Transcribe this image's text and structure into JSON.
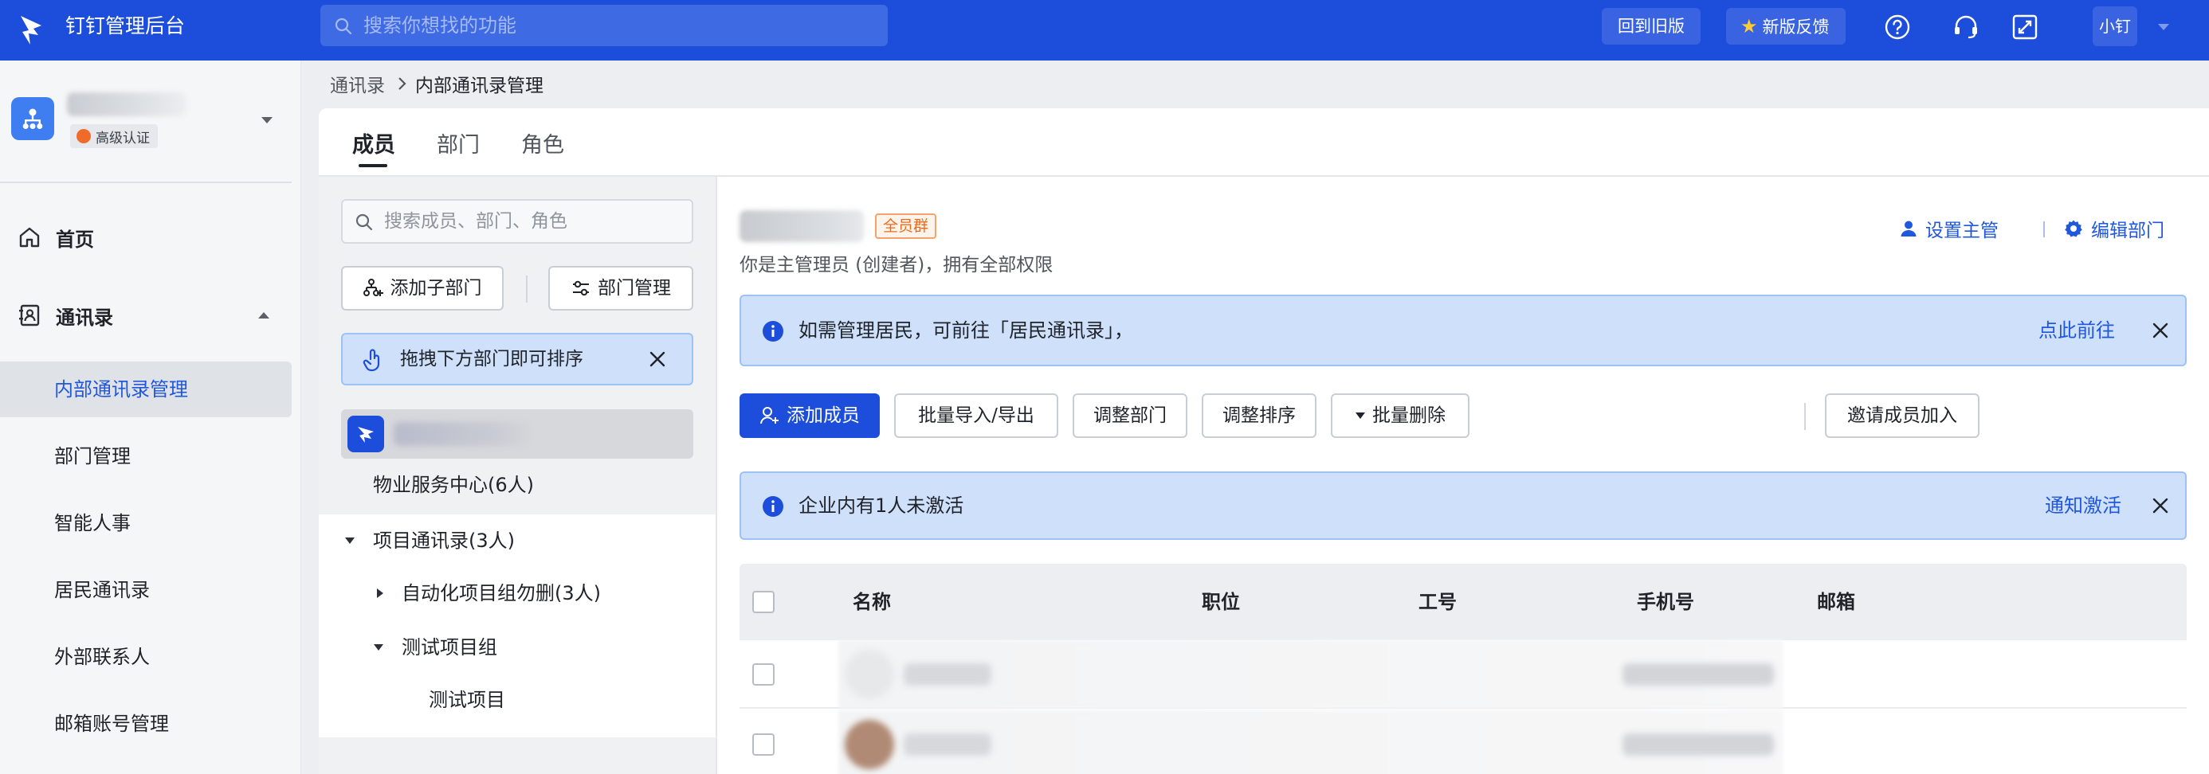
{
  "topbar": {
    "app_title": "钉钉管理后台",
    "search_placeholder": "搜索你想找的功能",
    "back_old_label": "回到旧版",
    "feedback_label": "新版反馈",
    "user_label": "小钉",
    "brand_color": "#1d4ddb"
  },
  "sidebar": {
    "org_badge": "高级认证",
    "home_label": "首页",
    "contacts_label": "通讯录",
    "items": [
      {
        "label": "内部通讯录管理",
        "active": true
      },
      {
        "label": "部门管理"
      },
      {
        "label": "智能人事"
      },
      {
        "label": "居民通讯录"
      },
      {
        "label": "外部联系人"
      },
      {
        "label": "邮箱账号管理"
      }
    ]
  },
  "breadcrumb": {
    "root": "通讯录",
    "current": "内部通讯录管理"
  },
  "tabs": [
    {
      "label": "成员",
      "active": true
    },
    {
      "label": "部门"
    },
    {
      "label": "角色"
    }
  ],
  "left_panel": {
    "search_placeholder": "搜索成员、部门、角色",
    "add_sub_dept": "添加子部门",
    "dept_manage": "部门管理",
    "drag_tip": "拖拽下方部门即可排序",
    "tree": [
      {
        "label": "物业服务中心(6人)"
      },
      {
        "label": "项目通讯录(3人)",
        "expanded": true
      },
      {
        "label": "自动化项目组勿删(3人)",
        "expanded": false
      },
      {
        "label": "测试项目组",
        "expanded": true
      },
      {
        "label": "测试项目"
      }
    ]
  },
  "right_panel": {
    "dept_tag": "全员群",
    "permission_text": "你是主管理员 (创建者)，拥有全部权限",
    "set_manager": "设置主管",
    "edit_dept": "编辑部门",
    "banner1": {
      "text": "如需管理居民，可前往「居民通讯录」，",
      "action": "点此前往"
    },
    "actions": {
      "add_member": "添加成员",
      "batch_import": "批量导入/导出",
      "adjust_dept": "调整部门",
      "adjust_order": "调整排序",
      "batch_delete": "批量删除",
      "invite": "邀请成员加入"
    },
    "banner2": {
      "text": "企业内有1人未激活",
      "action": "通知激活"
    },
    "table": {
      "columns": [
        "名称",
        "职位",
        "工号",
        "手机号",
        "邮箱"
      ]
    }
  },
  "colors": {
    "accent": "#1d4ddb",
    "link": "#1f57dd",
    "banner_bg": "#cfe0fb",
    "tag_orange": "#ee6a1a"
  }
}
